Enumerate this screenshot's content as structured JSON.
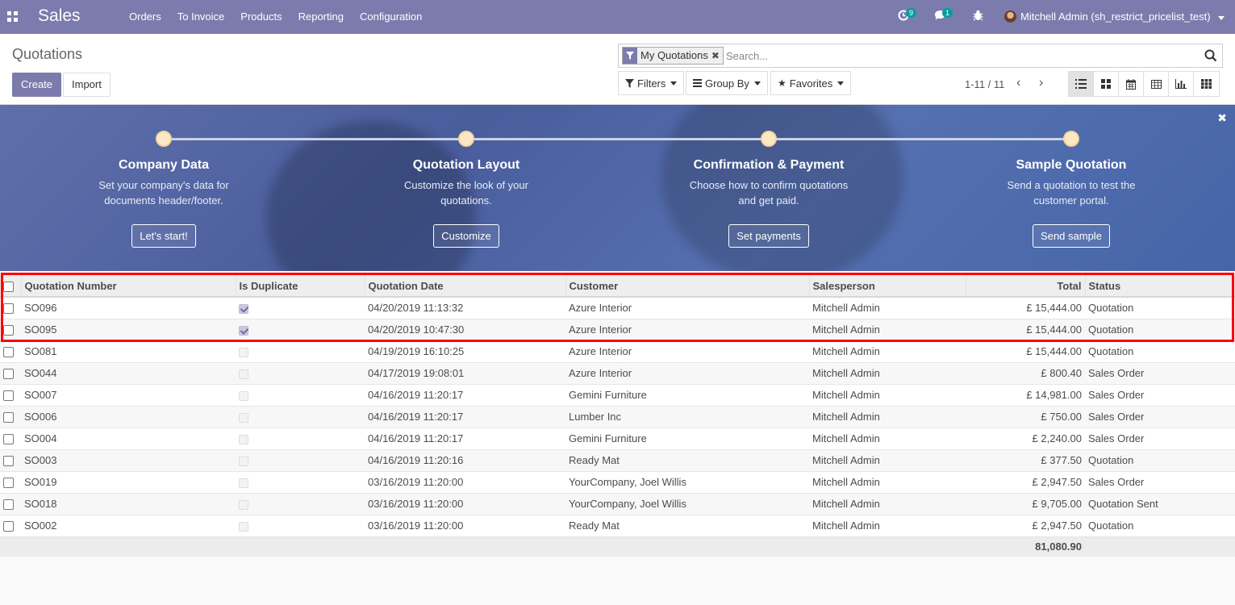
{
  "navbar": {
    "app_name": "Sales",
    "menu": [
      "Orders",
      "To Invoice",
      "Products",
      "Reporting",
      "Configuration"
    ],
    "activity_count": "9",
    "message_count": "1",
    "user": "Mitchell Admin (sh_restrict_pricelist_test)"
  },
  "control_panel": {
    "title": "Quotations",
    "create_label": "Create",
    "import_label": "Import",
    "facet_label": "My Quotations",
    "search_placeholder": "Search...",
    "filters_label": "Filters",
    "groupby_label": "Group By",
    "favorites_label": "Favorites",
    "pager": "1-11 / 11"
  },
  "banner": {
    "steps": [
      {
        "title": "Company Data",
        "desc1": "Set your company's data for",
        "desc2": "documents header/footer.",
        "button": "Let's start!"
      },
      {
        "title": "Quotation Layout",
        "desc1": "Customize the look of your",
        "desc2": "quotations.",
        "button": "Customize"
      },
      {
        "title": "Confirmation & Payment",
        "desc1": "Choose how to confirm quotations",
        "desc2": "and get paid.",
        "button": "Set payments"
      },
      {
        "title": "Sample Quotation",
        "desc1": "Send a quotation to test the",
        "desc2": "customer portal.",
        "button": "Send sample"
      }
    ]
  },
  "table": {
    "columns": [
      "Quotation Number",
      "Is Duplicate",
      "Quotation Date",
      "Customer",
      "Salesperson",
      "Total",
      "Status"
    ],
    "rows": [
      {
        "number": "SO096",
        "duplicate": true,
        "date": "04/20/2019 11:13:32",
        "customer": "Azure Interior",
        "salesperson": "Mitchell Admin",
        "total": "£ 15,444.00",
        "status": "Quotation"
      },
      {
        "number": "SO095",
        "duplicate": true,
        "date": "04/20/2019 10:47:30",
        "customer": "Azure Interior",
        "salesperson": "Mitchell Admin",
        "total": "£ 15,444.00",
        "status": "Quotation"
      },
      {
        "number": "SO081",
        "duplicate": false,
        "date": "04/19/2019 16:10:25",
        "customer": "Azure Interior",
        "salesperson": "Mitchell Admin",
        "total": "£ 15,444.00",
        "status": "Quotation"
      },
      {
        "number": "SO044",
        "duplicate": false,
        "date": "04/17/2019 19:08:01",
        "customer": "Azure Interior",
        "salesperson": "Mitchell Admin",
        "total": "£ 800.40",
        "status": "Sales Order"
      },
      {
        "number": "SO007",
        "duplicate": false,
        "date": "04/16/2019 11:20:17",
        "customer": "Gemini Furniture",
        "salesperson": "Mitchell Admin",
        "total": "£ 14,981.00",
        "status": "Sales Order"
      },
      {
        "number": "SO006",
        "duplicate": false,
        "date": "04/16/2019 11:20:17",
        "customer": "Lumber Inc",
        "salesperson": "Mitchell Admin",
        "total": "£ 750.00",
        "status": "Sales Order"
      },
      {
        "number": "SO004",
        "duplicate": false,
        "date": "04/16/2019 11:20:17",
        "customer": "Gemini Furniture",
        "salesperson": "Mitchell Admin",
        "total": "£ 2,240.00",
        "status": "Sales Order"
      },
      {
        "number": "SO003",
        "duplicate": false,
        "date": "04/16/2019 11:20:16",
        "customer": "Ready Mat",
        "salesperson": "Mitchell Admin",
        "total": "£ 377.50",
        "status": "Quotation"
      },
      {
        "number": "SO019",
        "duplicate": false,
        "date": "03/16/2019 11:20:00",
        "customer": "YourCompany, Joel Willis",
        "salesperson": "Mitchell Admin",
        "total": "£ 2,947.50",
        "status": "Sales Order"
      },
      {
        "number": "SO018",
        "duplicate": false,
        "date": "03/16/2019 11:20:00",
        "customer": "YourCompany, Joel Willis",
        "salesperson": "Mitchell Admin",
        "total": "£ 9,705.00",
        "status": "Quotation Sent"
      },
      {
        "number": "SO002",
        "duplicate": false,
        "date": "03/16/2019 11:20:00",
        "customer": "Ready Mat",
        "salesperson": "Mitchell Admin",
        "total": "£ 2,947.50",
        "status": "Quotation"
      }
    ],
    "grand_total": "81,080.90"
  },
  "colors": {
    "brand": "#7c7bad",
    "highlight": "#ff0000"
  }
}
